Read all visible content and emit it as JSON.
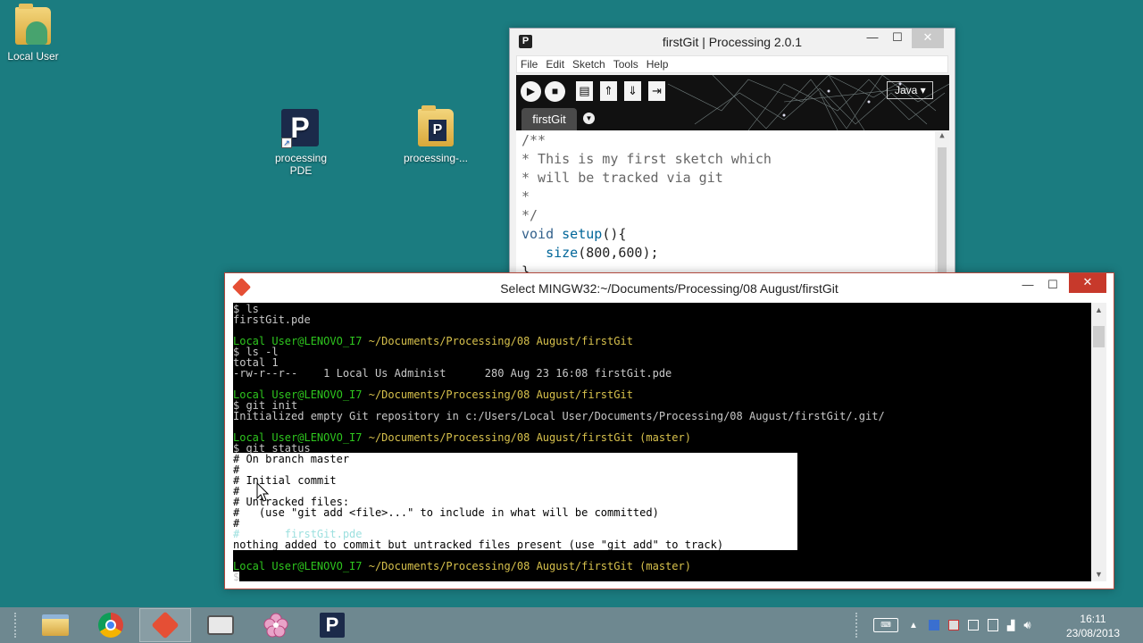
{
  "desktop": {
    "icons": [
      {
        "label": "Local User"
      },
      {
        "label": "processing\nPDE"
      },
      {
        "label": "processing-..."
      }
    ]
  },
  "processing_window": {
    "title": "firstGit | Processing 2.0.1",
    "app_icon": "P",
    "menu": [
      "File",
      "Edit",
      "Sketch",
      "Tools",
      "Help"
    ],
    "mode": "Java ▾",
    "tab": "firstGit",
    "code": [
      "/**",
      "* This is my first sketch which",
      "* will be tracked via git",
      "*",
      "*/",
      "void setup(){",
      "   size(800,600);",
      "}"
    ]
  },
  "git_window": {
    "title": "Select MINGW32:~/Documents/Processing/08 August/firstGit",
    "lines": [
      {
        "text": "$ ls",
        "style": "plain"
      },
      {
        "text": "firstGit.pde",
        "style": "plain"
      },
      {
        "text": "",
        "style": "plain"
      },
      {
        "prompt": "Local User@LENOVO_I7",
        "path": " ~/Documents/Processing/08 August/firstGit",
        "style": "prompt"
      },
      {
        "text": "$ ls -l",
        "style": "plain"
      },
      {
        "text": "total 1",
        "style": "plain"
      },
      {
        "text": "-rw-r--r--    1 Local Us Administ      280 Aug 23 16:08 firstGit.pde",
        "style": "plain"
      },
      {
        "text": "",
        "style": "plain"
      },
      {
        "prompt": "Local User@LENOVO_I7",
        "path": " ~/Documents/Processing/08 August/firstGit",
        "style": "prompt"
      },
      {
        "text": "$ git init",
        "style": "plain"
      },
      {
        "text": "Initialized empty Git repository in c:/Users/Local User/Documents/Processing/08 August/firstGit/.git/",
        "style": "plain"
      },
      {
        "text": "",
        "style": "plain"
      },
      {
        "prompt": "Local User@LENOVO_I7",
        "path": " ~/Documents/Processing/08 August/firstGit (master)",
        "style": "prompt"
      },
      {
        "text": "$ git status",
        "style": "plain"
      },
      {
        "text": "# On branch master",
        "style": "inv"
      },
      {
        "text": "#",
        "style": "inv"
      },
      {
        "text": "# Initial commit",
        "style": "inv"
      },
      {
        "text": "#",
        "style": "inv"
      },
      {
        "text": "# Untracked files:",
        "style": "inv"
      },
      {
        "text": "#   (use \"git add <file>...\" to include in what will be committed)",
        "style": "inv"
      },
      {
        "text": "#",
        "style": "inv"
      },
      {
        "text": "#       firstGit.pde",
        "style": "inv-file"
      },
      {
        "text": "nothing added to commit but untracked files present (use \"git add\" to track)",
        "style": "inv"
      },
      {
        "text": "",
        "style": "plain"
      },
      {
        "prompt": "Local User@LENOVO_I7",
        "path": " ~/Documents/Processing/08 August/firstGit (master)",
        "style": "prompt"
      },
      {
        "text": "$",
        "style": "plain"
      }
    ]
  },
  "taskbar": {
    "clock_time": "16:11",
    "clock_date": "23/08/2013"
  },
  "colors": {
    "desktop": "#1b7c80",
    "prompt_green": "#2ec61e",
    "path_yellow": "#d7c14c",
    "close_red": "#c7392b"
  }
}
